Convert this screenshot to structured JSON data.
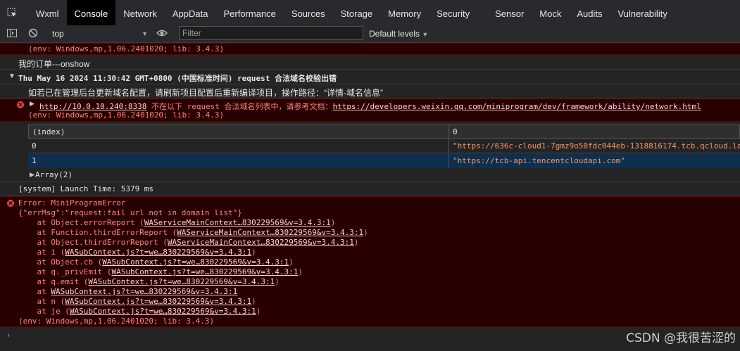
{
  "tabs": [
    "Wxml",
    "Console",
    "Network",
    "AppData",
    "Performance",
    "Sources",
    "Storage",
    "Memory",
    "Security",
    "Sensor",
    "Mock",
    "Audits",
    "Vulnerability"
  ],
  "active_tab": "Console",
  "toolbar": {
    "context": "top",
    "filter_placeholder": "Filter",
    "levels": "Default levels"
  },
  "console": {
    "env_top": "(env: Windows,mp,1.06.2401020; lib: 3.4.3)",
    "order_log": "我的订单---onshow",
    "group_header": "Thu May 16 2024 11:30:42 GMT+0800 (中国标准时间) request 合法域名校验出错",
    "group_hint": "如若已在管理后台更新域名配置，请刷新项目配置后重新编译项目，操作路径：“详情-域名信息”",
    "err2_url": "http://10.0.10.240:8338",
    "err2_msg": " 不在以下 request 合法域名列表中，请参考文档：",
    "err2_doc": "https://developers.weixin.qq.com/miniprogram/dev/framework/ability/network.html",
    "err2_env": "(env: Windows,mp,1.06.2401020; lib: 3.4.3)",
    "table": {
      "col_index": "(index)",
      "col_0": "0",
      "rows": [
        {
          "index": "0",
          "value": "\"https://636c-cloud1-7gmz9o50fdc044eb-1318816174.tcb.qcloud.la"
        },
        {
          "index": "1",
          "value": "\"https://tcb-api.tencentcloudapi.com\""
        }
      ],
      "array_label": "Array(2)"
    },
    "launch_time": "[system] Launch Time: 5379 ms",
    "err3_title": "Error: MiniProgramError",
    "err3_json": "{\"errMsg\":\"request:fail url not in domain list\"}",
    "stack": [
      {
        "fn": "    at Object.errorReport (",
        "link": "WAServiceMainContext…830229569&v=3.4.3:1",
        "end": ")"
      },
      {
        "fn": "    at Function.thirdErrorReport (",
        "link": "WAServiceMainContext…830229569&v=3.4.3:1",
        "end": ")"
      },
      {
        "fn": "    at Object.thirdErrorReport (",
        "link": "WAServiceMainContext…830229569&v=3.4.3:1",
        "end": ")"
      },
      {
        "fn": "    at i (",
        "link": "WASubContext.js?t=we…830229569&v=3.4.3:1",
        "end": ")"
      },
      {
        "fn": "    at Object.cb (",
        "link": "WASubContext.js?t=we…830229569&v=3.4.3:1",
        "end": ")"
      },
      {
        "fn": "    at q._privEmit (",
        "link": "WASubContext.js?t=we…830229569&v=3.4.3:1",
        "end": ")"
      },
      {
        "fn": "    at q.emit (",
        "link": "WASubContext.js?t=we…830229569&v=3.4.3:1",
        "end": ")"
      },
      {
        "fn": "    at ",
        "link": "WASubContext.js?t=we…830229569&v=3.4.3:1",
        "end": ""
      },
      {
        "fn": "    at n (",
        "link": "WASubContext.js?t=we…830229569&v=3.4.3:1",
        "end": ")"
      },
      {
        "fn": "    at je (",
        "link": "WASubContext.js?t=we…830229569&v=3.4.3:1",
        "end": ")"
      }
    ],
    "err3_env": "(env: Windows,mp,1.06.2401020; lib: 3.4.3)"
  },
  "watermark": "CSDN @我很苦涩的"
}
